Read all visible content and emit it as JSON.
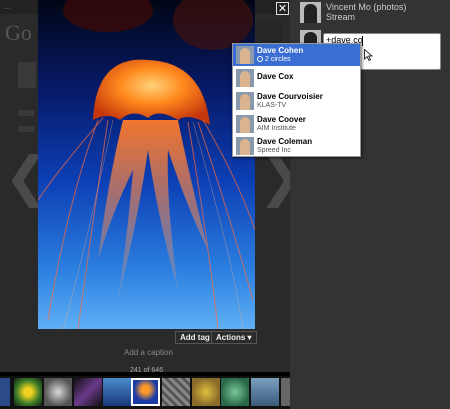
{
  "background_page": {
    "heading_fragment": "Go",
    "topbar_text": "..."
  },
  "viewer": {
    "close_glyph": "✕",
    "prev_glyph": "❮",
    "next_glyph": "❯",
    "add_tag_label": "Add tag",
    "actions_label": "Actions ▾",
    "caption_placeholder": "Add a caption",
    "counter": "241 of 646"
  },
  "panel": {
    "owner_name": "Vincent Mo (photos)",
    "owner_subtitle": "Stream",
    "comment_value": "+dave co"
  },
  "suggestions": [
    {
      "name": "Dave Cohen",
      "subtitle": "2 circles",
      "highlighted": true
    },
    {
      "name": "Dave Cox",
      "subtitle": ""
    },
    {
      "name": "Dave Courvoisier",
      "subtitle": "KLAS-TV"
    },
    {
      "name": "Dave Coover",
      "subtitle": "AIM Institute"
    },
    {
      "name": "Dave Coleman",
      "subtitle": "Spreed Inc"
    }
  ],
  "colors": {
    "highlight": "#3a6ed2",
    "panel_bg": "#333333",
    "page_bg": "#000000"
  },
  "icons": {
    "close": "close-icon",
    "cursor": "mouse-pointer-icon",
    "circle": "circle-icon"
  }
}
